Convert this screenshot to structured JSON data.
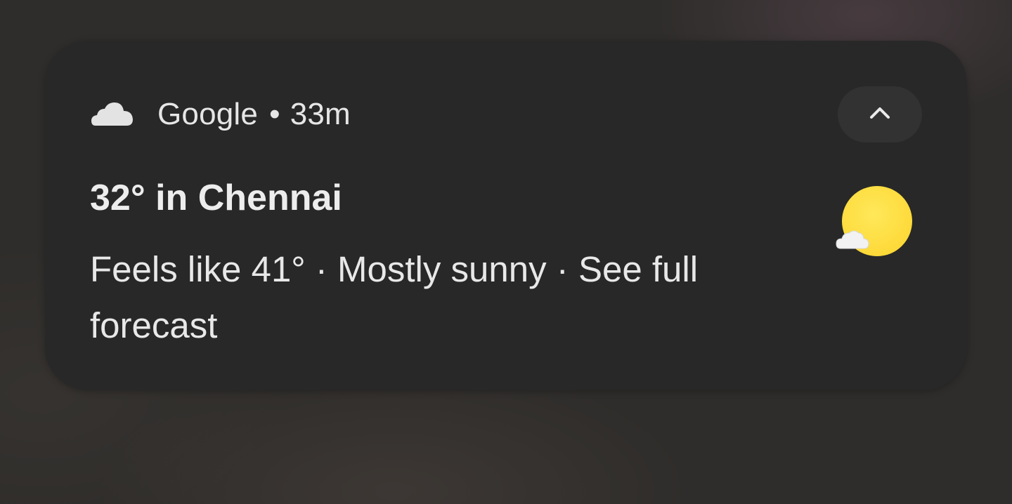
{
  "notification": {
    "app_icon": "cloud-icon",
    "app_name": "Google",
    "separator": "•",
    "time_ago": "33m",
    "collapse_icon": "chevron-up-icon",
    "title": "32° in Chennai",
    "body": "Feels like 41° · Mostly sunny · See full forecast",
    "weather_image": "mostly-sunny-icon"
  },
  "colors": {
    "card_background": "#282828",
    "sun": "#ffd93a",
    "text_primary": "#ededed"
  }
}
